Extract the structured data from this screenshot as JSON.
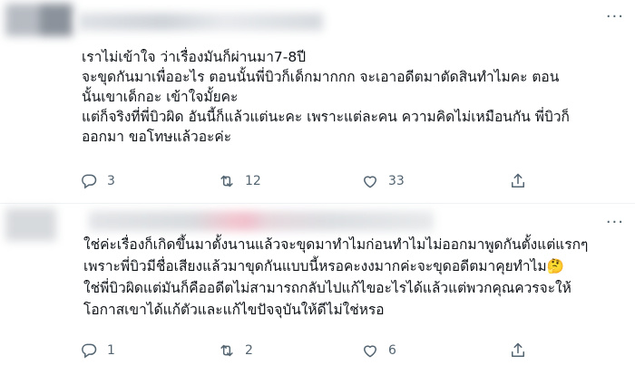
{
  "tweets": [
    {
      "text": "เราไม่เข้าใจ  ว่าเรื่องมันก็ผ่านมา7-8ปี\n จะขุดกันมาเพื่ออะไร ตอนนั้นพี่บิวก็เด็กมากกก   จะเอาอดีตมาตัดสินทำไมคะ   ตอน\nนั้นเขาเด็กอะ เข้าใจมั้ยคะ\nแต่ก็จริงที่พี่บิวผิด  อันนี้ก็แล้วแต่นะคะ เพราะแต่ละคน ความคิดไม่เหมือนกัน   พี่บิวก็\nออกมา ขอโทษแล้วอะค่ะ",
      "replies": "3",
      "retweets": "12",
      "likes": "33"
    },
    {
      "text": "ใช่ค่ะเรื่องก็เกิดขึ้นมาตั้งนานแล้วจะขุดมาทำไมก่อนทำไมไม่ออกมาพูดกันตั้งแต่แรกๆ\nเพราะพี่บิวมีชื่อเสียงแล้วมาขุดกันแบบนี้หรอคะงงมากค่ะจะขุดอดีตมาคุยทำไม🤔\nใช่พี่บิวผิดแต่มันก็คืออดีตไม่สามารถกลับไปแก้ไขอะไรได้แล้วแต่พวกคุณควรจะให้\nโอกาสเขาได้แก้ตัวและแก้ไขปัจจุบันให้ดีไม่ใช่หรอ",
      "replies": "1",
      "retweets": "2",
      "likes": "6"
    }
  ],
  "more_glyph": "···",
  "icons": [
    "reply-icon",
    "retweet-icon",
    "like-icon",
    "share-icon",
    "more-icon"
  ],
  "colors": {
    "muted": "#536471",
    "text": "#0f1419",
    "divider": "#eff3f4"
  }
}
